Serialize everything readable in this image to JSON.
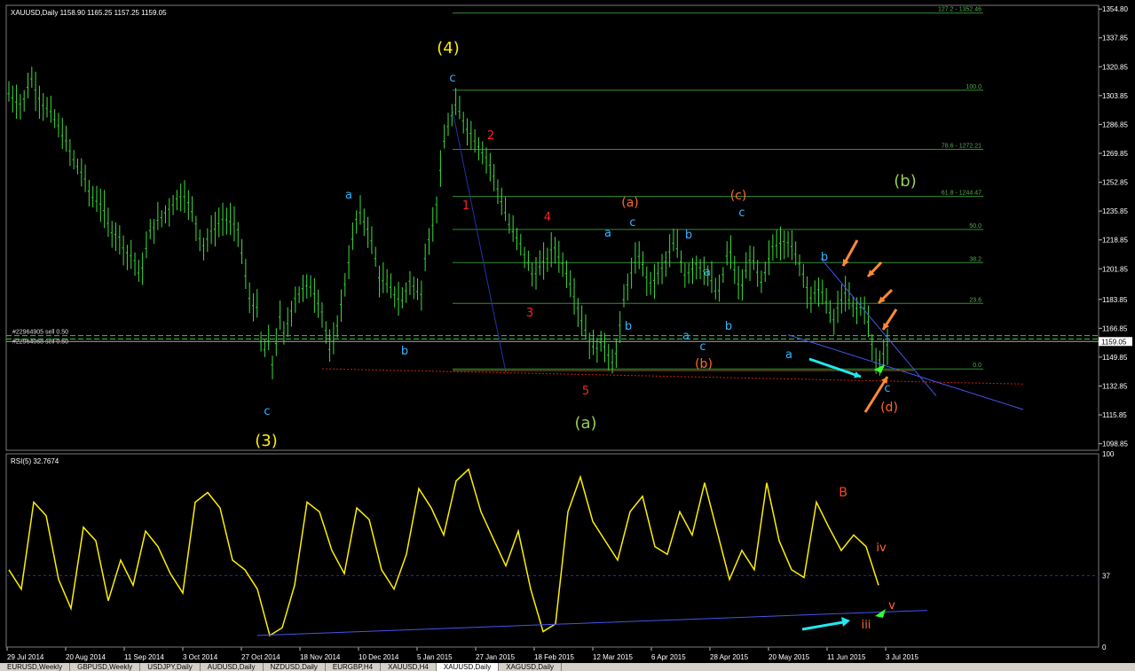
{
  "window": {
    "header": "XAUUSD,Daily  1158.90 1165.25 1157.25 1159.05",
    "order_lines": [
      "#22964905 sell 0.50",
      "#22964068 sell 0.50"
    ],
    "current_price_label": "1159.05",
    "tabs": [
      "EURUSD,Weekly",
      "GBPUSD,Weekly",
      "USDJPY,Daily",
      "AUDUSD,Daily",
      "NZDUSD,Daily",
      "EURGBP,H4",
      "XAUUSD,H4",
      "XAUUSD,Daily",
      "XAGUSD,Daily"
    ],
    "active_tab": 7
  },
  "chart_data": [
    {
      "type": "line",
      "title": "XAUUSD,Daily",
      "ohlc": {
        "open": 1158.9,
        "high": 1165.25,
        "low": 1157.25,
        "close": 1159.05
      },
      "y_axis_ticks": [
        "1354.80",
        "1337.85",
        "1320.85",
        "1303.85",
        "1286.85",
        "1269.85",
        "1252.85",
        "1235.85",
        "1218.85",
        "1201.85",
        "1183.85",
        "1166.85",
        "1149.85",
        "1132.85",
        "1115.85",
        "1098.85"
      ],
      "ylim": [
        1095,
        1357
      ],
      "x_axis_ticks": [
        "29 Jul 2014",
        "20 Aug 2014",
        "11 Sep 2014",
        "3 Oct 2014",
        "27 Oct 2014",
        "18 Nov 2014",
        "10 Dec 2014",
        "5 Jan 2015",
        "27 Jan 2015",
        "18 Feb 2015",
        "12 Mar 2015",
        "6 Apr 2015",
        "28 Apr 2015",
        "20 May 2015",
        "11 Jun 2015",
        "3 Jul 2015"
      ],
      "price_path": {
        "x": [
          0,
          5,
          8,
          12,
          16,
          20,
          24,
          27,
          30,
          34,
          37,
          40,
          43,
          46,
          48,
          52,
          56,
          60,
          64,
          68,
          71,
          75,
          79,
          84,
          88,
          91,
          93,
          95,
          97,
          99,
          101,
          103,
          105,
          108,
          111,
          115,
          118,
          122,
          125,
          128,
          132,
          136,
          140,
          144,
          147,
          151,
          153,
          156,
          160,
          164,
          168,
          172,
          176,
          180,
          184,
          188,
          192,
          196,
          200,
          205,
          210,
          214,
          218,
          222,
          226,
          231,
          235,
          240,
          244,
          248,
          252,
          256,
          260,
          264,
          268,
          272,
          276,
          280,
          285,
          290,
          294,
          298,
          302,
          306,
          310,
          314,
          316,
          318,
          320,
          322
        ],
        "close": [
          1305,
          1298,
          1315,
          1300,
          1292,
          1280,
          1265,
          1258,
          1245,
          1240,
          1225,
          1222,
          1212,
          1208,
          1196,
          1225,
          1232,
          1240,
          1247,
          1232,
          1215,
          1225,
          1232,
          1225,
          1185,
          1178,
          1150,
          1160,
          1142,
          1175,
          1162,
          1175,
          1185,
          1190,
          1192,
          1176,
          1150,
          1182,
          1210,
          1236,
          1225,
          1196,
          1190,
          1182,
          1195,
          1185,
          1215,
          1230,
          1282,
          1298,
          1285,
          1275,
          1265,
          1245,
          1225,
          1215,
          1198,
          1205,
          1215,
          1198,
          1172,
          1155,
          1158,
          1145,
          1190,
          1210,
          1192,
          1203,
          1218,
          1198,
          1205,
          1200,
          1185,
          1215,
          1188,
          1210,
          1192,
          1215,
          1220,
          1205,
          1185,
          1190,
          1170,
          1188,
          1178,
          1180,
          1160,
          1145,
          1150,
          1158
        ],
        "x_note": "days from 29 Jul 2014 (trading-day index)"
      },
      "fibonacci_levels": [
        {
          "label": "127.2 - 1352.46",
          "value": 1352.46
        },
        {
          "label": "100.0",
          "value": 1307.0
        },
        {
          "label": "78.6 - 1272.21",
          "value": 1272.21
        },
        {
          "label": "61.8 - 1244.47",
          "value": 1244.47
        },
        {
          "label": "50.0",
          "value": 1225.0
        },
        {
          "label": "38.2",
          "value": 1205.5
        },
        {
          "label": "23.6",
          "value": 1181.5
        },
        {
          "label": "0.0",
          "value": 1142.9
        }
      ],
      "wave_labels": [
        {
          "text": "(4)",
          "color": "#ffee00"
        },
        {
          "text": "(3)",
          "color": "#ffee00"
        },
        {
          "text": "c",
          "color": "#33b5ff"
        },
        {
          "text": "c",
          "color": "#33b5ff"
        },
        {
          "text": "a",
          "color": "#33b5ff"
        },
        {
          "text": "b",
          "color": "#33b5ff"
        },
        {
          "text": "1",
          "color": "#ff2020"
        },
        {
          "text": "2",
          "color": "#ff2020"
        },
        {
          "text": "3",
          "color": "#ff2020"
        },
        {
          "text": "4",
          "color": "#ff2020"
        },
        {
          "text": "5",
          "color": "#ff2020"
        },
        {
          "text": "(a)",
          "color": "#99cc55"
        },
        {
          "text": "(b)",
          "color": "#99cc55"
        },
        {
          "text": "(a)",
          "color": "#ff6a2a"
        },
        {
          "text": "(b)",
          "color": "#ff6a2a"
        },
        {
          "text": "(c)",
          "color": "#ff6a2a"
        },
        {
          "text": "(d)",
          "color": "#ff6a2a"
        },
        {
          "text": "a",
          "color": "#33b5ff"
        },
        {
          "text": "b",
          "color": "#33b5ff"
        },
        {
          "text": "c",
          "color": "#33b5ff"
        },
        {
          "text": "b",
          "color": "#33b5ff"
        },
        {
          "text": "a",
          "color": "#33b5ff"
        },
        {
          "text": "a",
          "color": "#33b5ff"
        },
        {
          "text": "c",
          "color": "#33b5ff"
        },
        {
          "text": "b",
          "color": "#33b5ff"
        },
        {
          "text": "c",
          "color": "#33b5ff"
        },
        {
          "text": "b",
          "color": "#33b5ff"
        },
        {
          "text": "a",
          "color": "#33b5ff"
        },
        {
          "text": "c",
          "color": "#33b5ff"
        }
      ]
    },
    {
      "type": "line",
      "title": "RSI(5) 32.7674",
      "ylim": [
        0,
        100
      ],
      "y_axis_ticks": [
        "100",
        "37",
        "0"
      ],
      "reference_level": 37,
      "series": [
        {
          "values": [
            40,
            30,
            75,
            68,
            35,
            20,
            62,
            55,
            24,
            45,
            32,
            60,
            52,
            38,
            28,
            75,
            80,
            72,
            45,
            40,
            30,
            6,
            10,
            32,
            75,
            70,
            50,
            38,
            72,
            66,
            40,
            30,
            48,
            82,
            72,
            58,
            86,
            92,
            70,
            56,
            42,
            60,
            30,
            8,
            12,
            70,
            88,
            65,
            55,
            45,
            70,
            78,
            52,
            48,
            70,
            58,
            85,
            60,
            35,
            50,
            40,
            85,
            55,
            40,
            36,
            75,
            62,
            50,
            58,
            52,
            32
          ],
          "labels": [
            "B",
            "iv",
            "v",
            "iii"
          ]
        }
      ]
    }
  ]
}
